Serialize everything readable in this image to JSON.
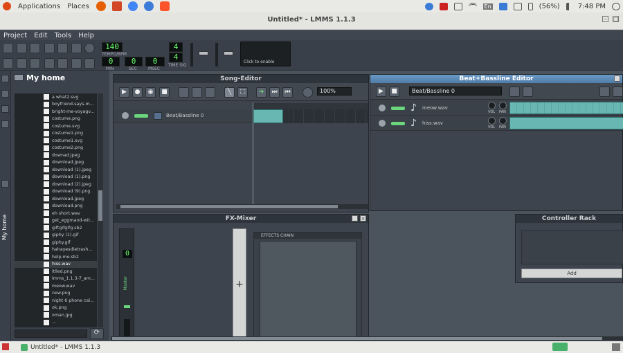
{
  "system_panel": {
    "applications": "Applications",
    "places": "Places",
    "lang": "En",
    "battery": "(56%)",
    "clock": "7:48 PM"
  },
  "window": {
    "title": "Untitled* - LMMS 1.1.3"
  },
  "menu": [
    "Project",
    "Edit",
    "Tools",
    "Help"
  ],
  "toolbar": {
    "tempo_value": "140",
    "tempo_label": "TEMPO/BPM",
    "time_min": "0",
    "time_sec": "0",
    "time_msec": "0",
    "min_label": "MIN",
    "sec_label": "SEC",
    "msec_label": "MSEC",
    "timesig_num": "4",
    "timesig_den": "4",
    "timesig_label": "TIME SIG",
    "cpu_text": "Click to enable"
  },
  "browser": {
    "title": "My home",
    "sidebar_tab": "My home",
    "files": [
      "a what2.svg",
      "boyfriend-says-m...",
      "bright-me-voyagv...",
      "costume.png",
      "costume.svg",
      "costume1.png",
      "costume1.svg",
      "costume2.png",
      "downad.jpeg",
      "download.jpeg",
      "download (1).jpeg",
      "download (1).png",
      "download (2).jpeg",
      "download (9).png",
      "download.jpeg",
      "download.png",
      "eh short.wav",
      "get_eggmand-wit...",
      "giftgifgifg.sb2",
      "giphy (1).gif",
      "giphy.gif",
      "hahayesdietrash...",
      "help.me.sb2",
      "hiss.wav",
      "itlled.png",
      "lmms_1.1.3-7_am...",
      "meow.wav",
      "new.png",
      "night 6 phone cal...",
      "ok.png",
      "oman.jpg",
      "..."
    ],
    "selected_file": "hiss.wav"
  },
  "song_editor": {
    "title": "Song-Editor",
    "zoom": "100%",
    "track_name": "Beat/Bassline 0"
  },
  "bb_editor": {
    "title": "Beat+Bassline Editor",
    "selected_pattern": "Beat/Bassline 0",
    "tracks": [
      {
        "name": "meow.wav",
        "vol_label": "VOL",
        "pan_label": "PAN"
      },
      {
        "name": "hiss.wav",
        "vol_label": "VOL",
        "pan_label": "PAN"
      }
    ]
  },
  "fx_mixer": {
    "title": "FX-Mixer",
    "channel_number": "0",
    "channel_label": "Master",
    "effects_chain_label": "EFFECTS CHAIN",
    "add_symbol": "+"
  },
  "controller_rack": {
    "title": "Controller Rack",
    "add_label": "Add"
  },
  "taskbar": {
    "task_label": "Untitled* - LMMS 1.1.3"
  }
}
